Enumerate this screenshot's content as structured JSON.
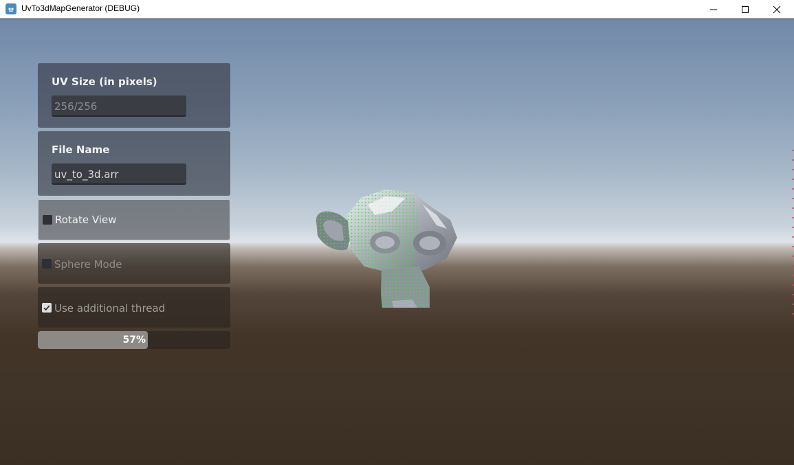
{
  "window": {
    "title": "UvTo3dMapGenerator (DEBUG)",
    "icon": "godot-icon",
    "controls": [
      "minimize-icon",
      "maximize-icon",
      "close-icon"
    ]
  },
  "panels": {
    "uv_size": {
      "label": "UV Size (in pixels)",
      "placeholder": "256/256",
      "value": ""
    },
    "file_name": {
      "label": "File Name",
      "value": "uv_to_3d.arr"
    },
    "rotate_view": {
      "label": "Rotate View",
      "checked": false
    },
    "sphere_mode": {
      "label": "Sphere Mode",
      "checked": false,
      "disabled": true
    },
    "additional_thread": {
      "label": "Use additional thread",
      "checked": true,
      "disabled": true
    }
  },
  "progress": {
    "value": 0.57,
    "label": "57%"
  },
  "colors": {
    "wireframe": "#2fe82f",
    "mesh": "#8f939c",
    "accent": "#478cbf"
  }
}
